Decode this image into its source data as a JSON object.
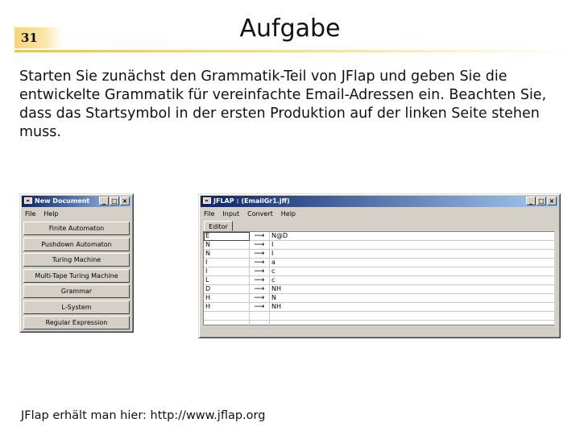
{
  "slide": {
    "number": "31",
    "title": "Aufgabe",
    "body": "Starten Sie zunächst den Grammatik-Teil von JFlap und geben Sie die entwickelte Grammatik für vereinfachte Email-Adressen ein. Beachten Sie, dass das Startsymbol in der ersten Produktion auf der linken Seite stehen muss.",
    "footer": "JFlap erhält man hier: http://www.jflap.org"
  },
  "new_document": {
    "title": "New Document",
    "menu": [
      "File",
      "Help"
    ],
    "buttons": [
      "Finite Automaton",
      "Pushdown Automaton",
      "Turing Machine",
      "Multi-Tape Turing Machine",
      "Grammar",
      "L-System",
      "Regular Expression"
    ]
  },
  "jflap_editor": {
    "title": "JFLAP : (EmailGr1.jff)",
    "menu": [
      "File",
      "Input",
      "Convert",
      "Help"
    ],
    "tab": "Editor",
    "productions": [
      {
        "lhs": "E",
        "arrow": "⟶",
        "rhs": "N@D"
      },
      {
        "lhs": "N",
        "arrow": "⟶",
        "rhs": "I"
      },
      {
        "lhs": "N",
        "arrow": "⟶",
        "rhs": "I"
      },
      {
        "lhs": "I",
        "arrow": "⟶",
        "rhs": "a"
      },
      {
        "lhs": "I",
        "arrow": "⟶",
        "rhs": "c"
      },
      {
        "lhs": "L",
        "arrow": "⟶",
        "rhs": "c"
      },
      {
        "lhs": "D",
        "arrow": "⟶",
        "rhs": "NH"
      },
      {
        "lhs": "H",
        "arrow": "⟶",
        "rhs": "N"
      },
      {
        "lhs": "H",
        "arrow": "⟶",
        "rhs": "NH"
      },
      {
        "lhs": "",
        "arrow": "",
        "rhs": ""
      },
      {
        "lhs": "",
        "arrow": "",
        "rhs": ""
      }
    ]
  },
  "window_controls": {
    "minimize": "_",
    "maximize": "□",
    "close": "×"
  }
}
